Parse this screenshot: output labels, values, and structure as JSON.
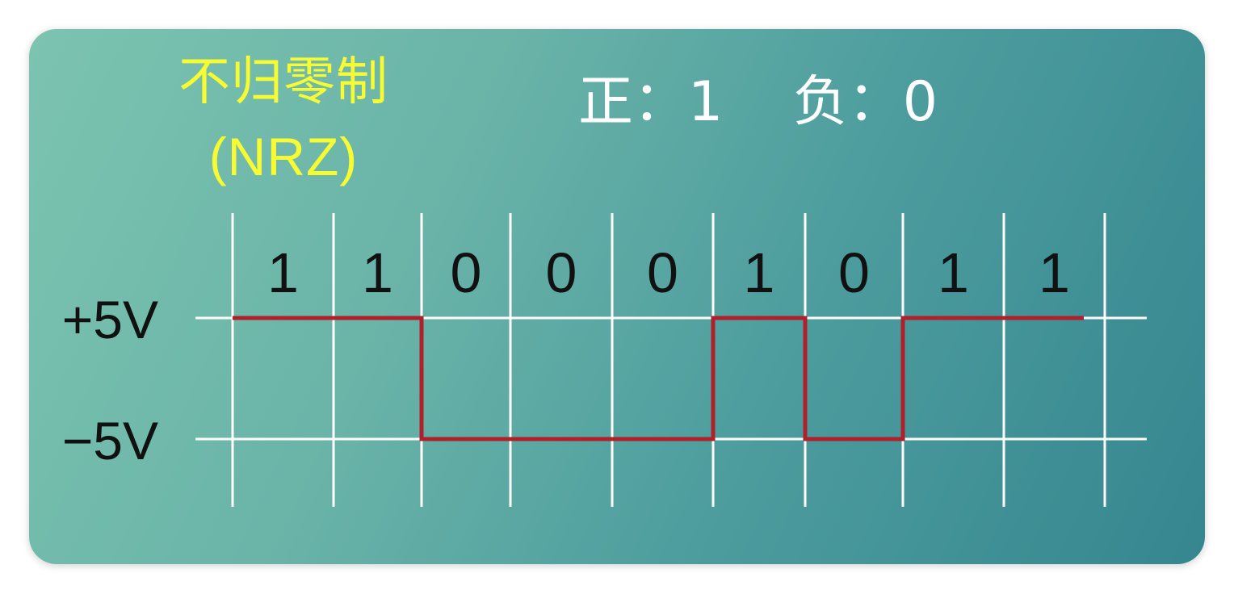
{
  "title": {
    "main": "不归零制",
    "abbr": "(NRZ)"
  },
  "legend": {
    "positive": "正：1",
    "negative": "负：0"
  },
  "levels": {
    "high": "+5V",
    "low": "−5V"
  },
  "bits": [
    "1",
    "1",
    "0",
    "0",
    "0",
    "1",
    "0",
    "1",
    "1"
  ],
  "colors": {
    "title": "#f6fb32",
    "signal": "#b0202a",
    "grid": "#ffffff",
    "background_start": "#7cc4b0",
    "background_end": "#35868f"
  }
}
